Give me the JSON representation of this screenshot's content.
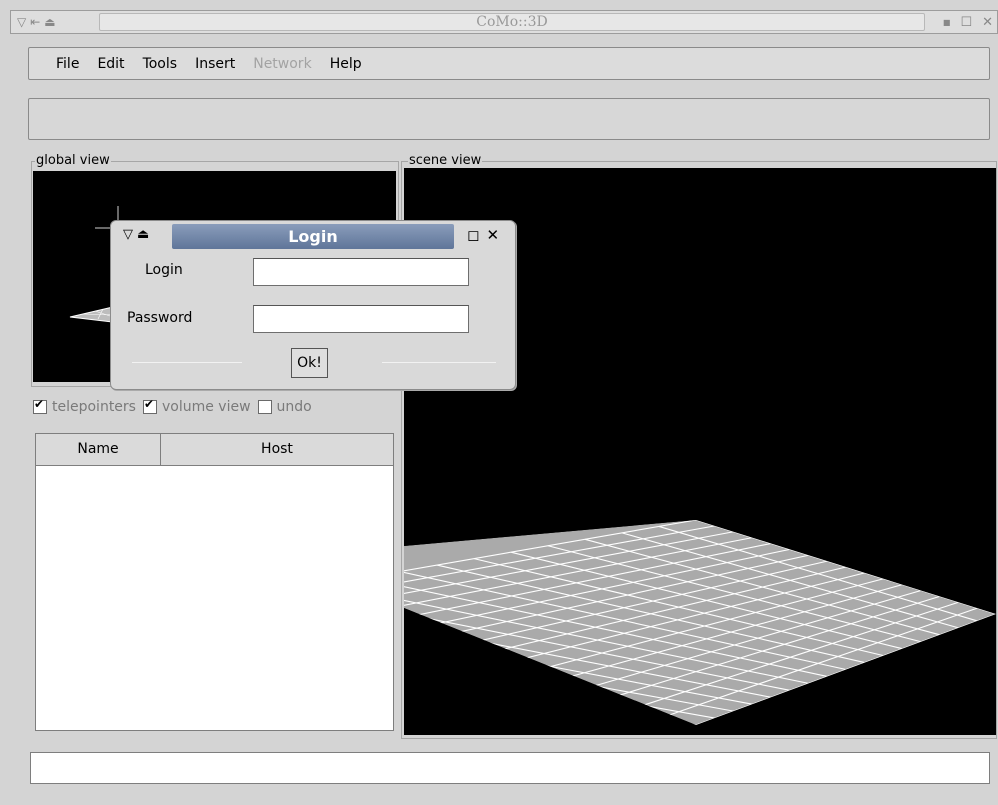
{
  "window": {
    "title": "CoMo::3D",
    "left_icons": [
      "menu-triangle-icon",
      "shade-icon",
      "eject-icon"
    ],
    "right_icons": [
      "minimize-icon",
      "maximize-icon",
      "close-icon"
    ]
  },
  "menubar": {
    "items": [
      {
        "label": "File",
        "enabled": true
      },
      {
        "label": "Edit",
        "enabled": true
      },
      {
        "label": "Tools",
        "enabled": true
      },
      {
        "label": "Insert",
        "enabled": true
      },
      {
        "label": "Network",
        "enabled": false
      },
      {
        "label": "Help",
        "enabled": true
      }
    ]
  },
  "global_view": {
    "label": "global view"
  },
  "scene_view": {
    "label": "scene view"
  },
  "options": {
    "telepointers": {
      "label": "telepointers",
      "checked": true
    },
    "volume_view": {
      "label": "volume view",
      "checked": true
    },
    "undo": {
      "label": "undo",
      "checked": false
    }
  },
  "user_list": {
    "columns": [
      "Name",
      "Host"
    ],
    "rows": []
  },
  "status": {
    "text": ""
  },
  "login_dialog": {
    "title": "Login",
    "login_label": "Login",
    "login_value": "",
    "password_label": "Password",
    "password_value": "",
    "ok_label": "Ok!"
  },
  "colors": {
    "dialog_title_bar": "#6f84a8",
    "viewport_background": "#000000",
    "grid_fill": "#aaaaaa",
    "grid_lines": "#ffffff"
  }
}
